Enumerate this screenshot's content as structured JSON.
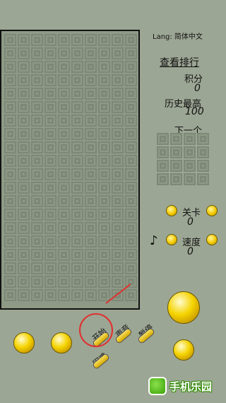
{
  "lang_label": "Lang: 简体中文",
  "rank_link": "查看排行",
  "score": {
    "label": "积分",
    "value": "0"
  },
  "high_score": {
    "label": "历史最高",
    "value": "100"
  },
  "next_label": "下一个",
  "level": {
    "label": "关卡",
    "value": "0"
  },
  "speed": {
    "label": "速度",
    "value": "0"
  },
  "music_icon": "♪",
  "buttons": {
    "start": "开始",
    "sound": "声音",
    "pause": "暂停",
    "difficulty": "困难"
  },
  "watermark": "手机乐园"
}
